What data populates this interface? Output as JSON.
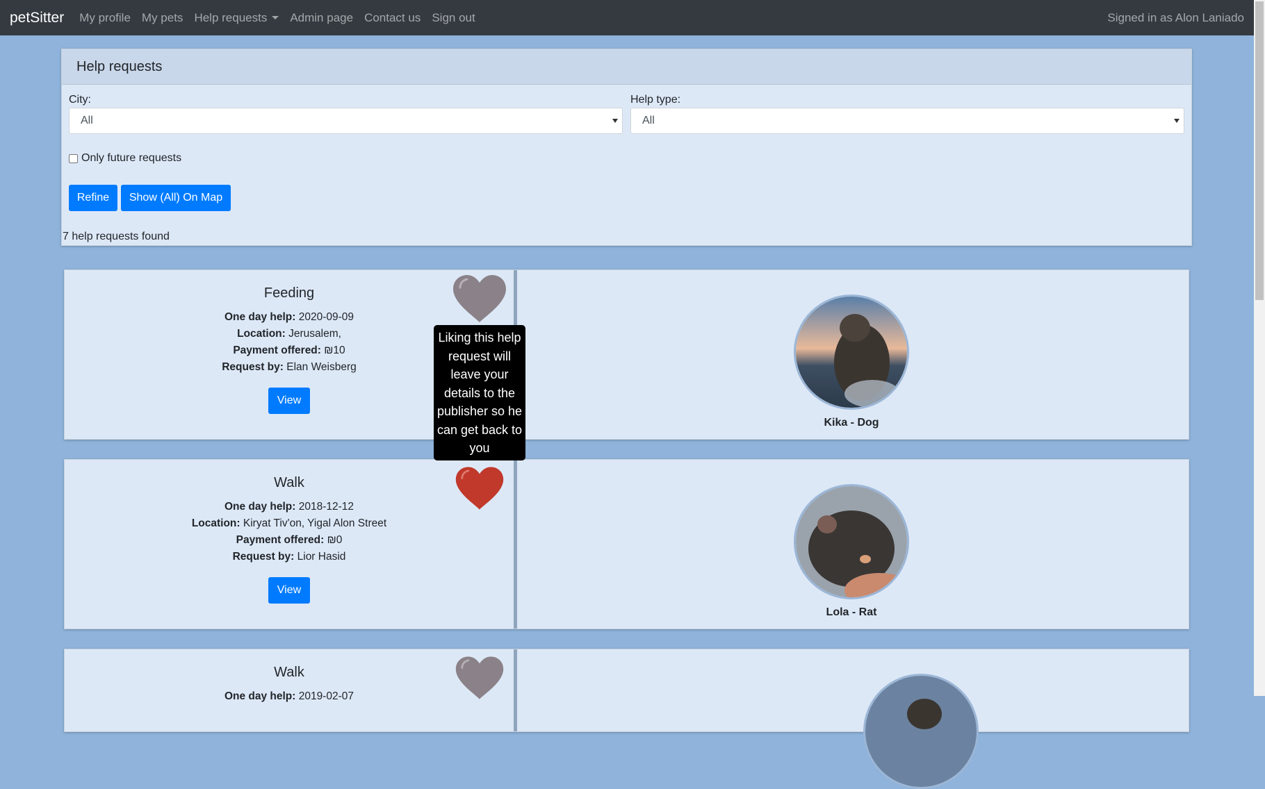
{
  "navbar": {
    "brand": "petSitter",
    "links": [
      "My profile",
      "My pets",
      "Help requests",
      "Admin page",
      "Contact us",
      "Sign out"
    ],
    "signed_in": "Signed in as Alon Laniado"
  },
  "filters": {
    "title": "Help requests",
    "city_label": "City:",
    "city_value": "All",
    "type_label": "Help type:",
    "type_value": "All",
    "future_label": "Only future requests",
    "refine_label": "Refine",
    "map_label": "Show (All) On Map",
    "found_text": "7 help requests found"
  },
  "labels": {
    "date": "One day help:",
    "location": "Location:",
    "payment": "Payment offered:",
    "request_by": "Request by:",
    "view": "View"
  },
  "tooltip": "Liking this help request will leave your details to the publisher so he can get back to you",
  "requests": [
    {
      "type": "Feeding",
      "date": "2020-09-09",
      "location": "Jerusalem,",
      "payment": "₪10",
      "request_by": "Elan Weisberg",
      "pet": "Kika - Dog",
      "liked": false
    },
    {
      "type": "Walk",
      "date": "2018-12-12",
      "location": "Kiryat Tiv'on, Yigal Alon Street",
      "payment": "₪0",
      "request_by": "Lior Hasid",
      "pet": "Lola - Rat",
      "liked": true
    },
    {
      "type": "Walk",
      "date": "2019-02-07",
      "liked": false
    }
  ],
  "colors": {
    "heart_liked": "#c0392b",
    "heart_unliked": "#8a8288",
    "primary": "#007bff"
  }
}
